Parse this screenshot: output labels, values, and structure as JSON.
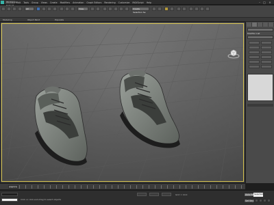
{
  "title_bar": {
    "workspace": "Workspace: Default",
    "app": "Autodesk 3ds Max 2014 x64",
    "file": "Sneakers_1.max",
    "search_placeholder": "Type a keyword or phrase",
    "signin": "Sign In"
  },
  "menu": [
    "Edit",
    "Tools",
    "Group",
    "Views",
    "Create",
    "Modifiers",
    "Animation",
    "Graph Editors",
    "Rendering",
    "Customize",
    "MAXScript",
    "Help"
  ],
  "toolbar": {
    "selection_filter": "All",
    "reference": "View",
    "selection_set": "Create Selection Se"
  },
  "ribbon": {
    "left": "Object Paint",
    "mid": "Populate",
    "modeling": "Modeling"
  },
  "viewport": {
    "label": "[+] [Perspective] [Shaded]",
    "accent": "#d4c04a"
  },
  "command_panel": {
    "modifier_list": "Modifier List"
  },
  "trackbar": {
    "frame": "0 / 100",
    "ticks": [
      "0",
      "10",
      "20",
      "30",
      "40",
      "50",
      "60",
      "70",
      "80",
      "90",
      "100"
    ]
  },
  "status": {
    "message": "Click or click-and-drag to select objects",
    "add_time_tag": "Add Time Tag",
    "grid": "Grid = 10.0",
    "auto_key": "Auto Key",
    "set_key": "Set Key",
    "selected": "Selected",
    "key_filters": "Key Filters..."
  }
}
